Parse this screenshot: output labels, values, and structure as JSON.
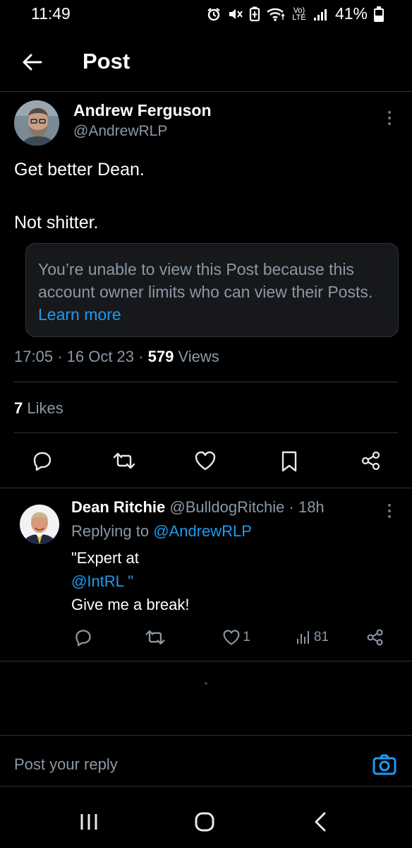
{
  "status_bar": {
    "time": "11:49",
    "battery": "41%",
    "network": "Vo) LTE",
    "icons": [
      "alarm-icon",
      "mute-icon",
      "battery-saver-icon",
      "wifi-icon",
      "volte-icon",
      "signal-icon",
      "battery-icon"
    ]
  },
  "header": {
    "title": "Post",
    "back_icon": "arrow-left-icon"
  },
  "post": {
    "author_name": "Andrew Ferguson",
    "author_handle": "@AndrewRLP",
    "text_line1": "Get better Dean.",
    "text_line2": "Not shitter.",
    "quote_notice": "You’re unable to view this Post because this account owner limits who can view their Posts.",
    "quote_link": "Learn more",
    "time": "17:05",
    "date": "16 Oct 23",
    "views_count": "579",
    "views_label": "Views",
    "likes_count": "7",
    "likes_label": "Likes",
    "actions": [
      "reply-icon",
      "repost-icon",
      "like-icon",
      "bookmark-icon",
      "share-icon"
    ]
  },
  "reply": {
    "author_name": "Dean Ritchie",
    "author_handle": "@BulldogRitchie",
    "age": "18h",
    "replying_prefix": "Replying to",
    "replying_to": "@AndrewRLP",
    "line1": "\"Expert at",
    "line2": "@IntRL \"",
    "line3": "Give me a break!",
    "like_count": "1",
    "views_count": "81"
  },
  "composer": {
    "placeholder": "Post your reply",
    "camera_icon": "camera-icon"
  },
  "colors": {
    "background": "#000000",
    "text": "#e7e9ea",
    "secondary_text": "#8b98a5",
    "accent": "#1d9bf0",
    "border": "#2f3336",
    "quote_background": "#16181c"
  }
}
